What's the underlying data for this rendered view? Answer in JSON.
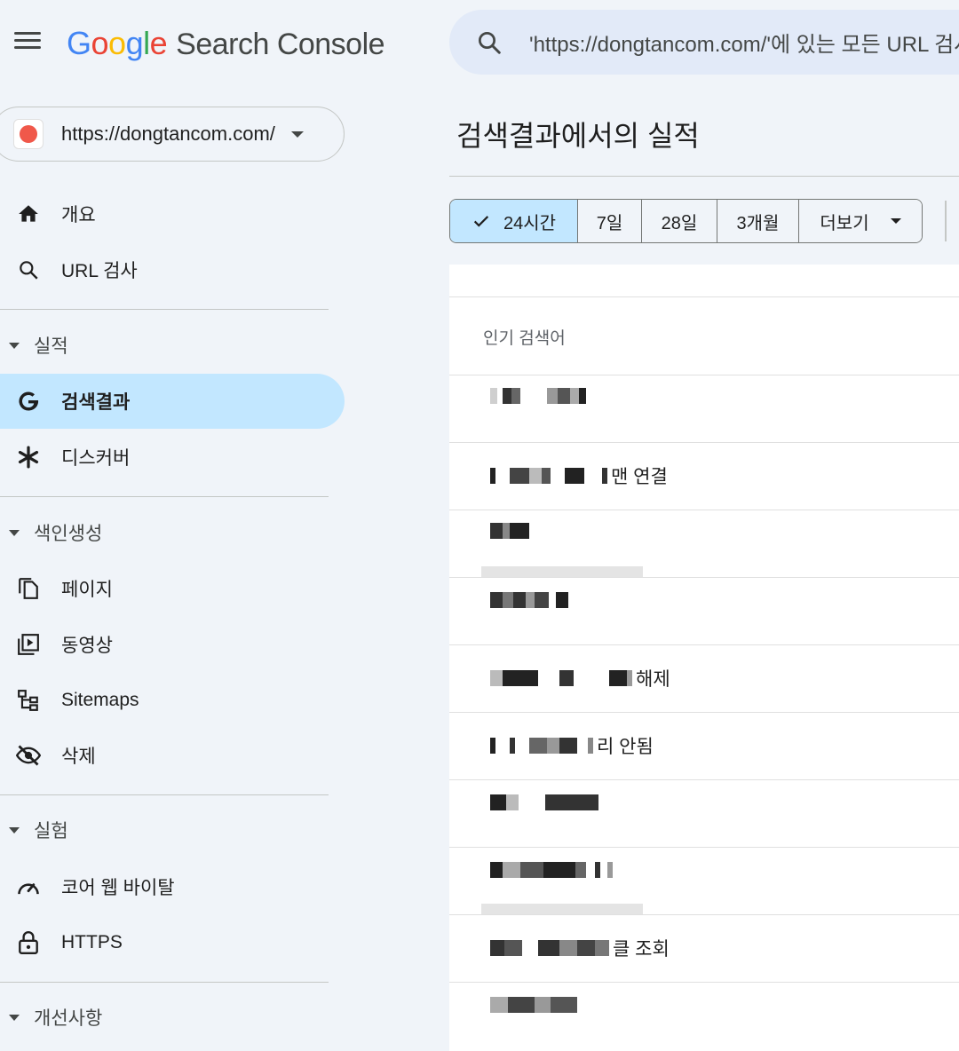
{
  "header": {
    "logo_parts": [
      "G",
      "o",
      "o",
      "g",
      "l",
      "e"
    ],
    "product_name": "Search Console",
    "search_placeholder": "'https://dongtancom.com/'에 있는 모든 URL 검사"
  },
  "property": {
    "url": "https://dongtancom.com/"
  },
  "sidebar": {
    "items": [
      {
        "label": "개요",
        "icon": "home-icon"
      },
      {
        "label": "URL 검사",
        "icon": "search-icon"
      }
    ],
    "sections": [
      {
        "label": "실적",
        "items": [
          {
            "label": "검색결과",
            "icon": "google-g-icon",
            "active": true
          },
          {
            "label": "디스커버",
            "icon": "asterisk-icon"
          }
        ]
      },
      {
        "label": "색인생성",
        "items": [
          {
            "label": "페이지",
            "icon": "pages-icon"
          },
          {
            "label": "동영상",
            "icon": "video-icon"
          },
          {
            "label": "Sitemaps",
            "icon": "sitemap-icon"
          },
          {
            "label": "삭제",
            "icon": "eye-off-icon"
          }
        ]
      },
      {
        "label": "실험",
        "items": [
          {
            "label": "코어 웹 바이탈",
            "icon": "gauge-icon"
          },
          {
            "label": "HTTPS",
            "icon": "lock-icon"
          }
        ]
      },
      {
        "label": "개선사항",
        "items": []
      }
    ]
  },
  "main": {
    "title": "검색결과에서의 실적",
    "date_chips": [
      {
        "label": "24시간",
        "selected": true
      },
      {
        "label": "7일",
        "selected": false
      },
      {
        "label": "28일",
        "selected": false
      },
      {
        "label": "3개월",
        "selected": false
      },
      {
        "label": "더보기",
        "selected": false
      }
    ],
    "table": {
      "column_header": "인기 검색어",
      "rows": [
        {
          "suffix": ""
        },
        {
          "suffix": "맨 연결"
        },
        {
          "suffix": ""
        },
        {
          "suffix": ""
        },
        {
          "suffix": "해제"
        },
        {
          "suffix": "리 안됨"
        },
        {
          "suffix": ""
        },
        {
          "suffix": ""
        },
        {
          "suffix": "클 조회"
        },
        {
          "suffix": ""
        }
      ]
    }
  },
  "colors": {
    "background": "#f0f4f9",
    "active": "#c2e7ff",
    "search_bar": "#e2eaf8",
    "favicon": "#f0584a"
  }
}
